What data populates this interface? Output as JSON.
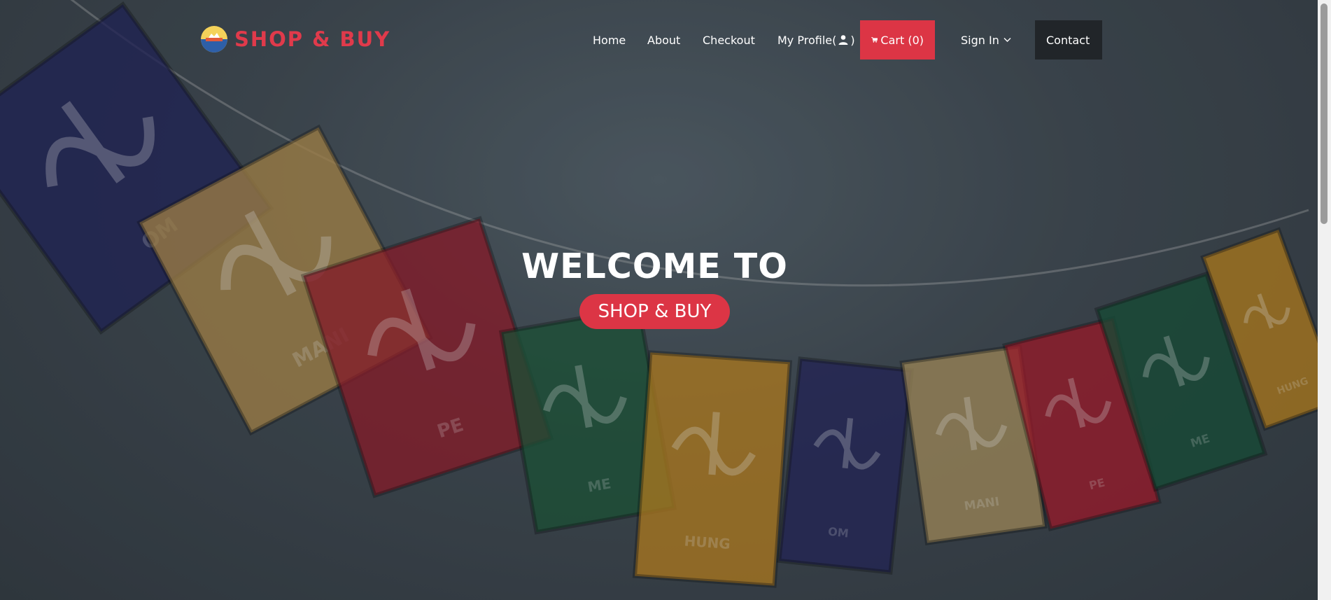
{
  "brand": {
    "name": "SHOP & BUY",
    "logo_icon": "sunrise-logo-icon"
  },
  "nav": {
    "home": "Home",
    "about": "About",
    "checkout": "Checkout",
    "profile": "My Profile(",
    "profile_close": ")",
    "cart": "Cart (0)",
    "signin": "Sign In",
    "contact": "Contact"
  },
  "hero": {
    "welcome": "WELCOME TO",
    "badge": "SHOP & BUY",
    "flag_labels": [
      "OM",
      "MANI",
      "PE",
      "ME",
      "HUNG",
      "OM",
      "MANI",
      "PE",
      "ME",
      "HUNG"
    ]
  },
  "colors": {
    "accent": "#dc3545",
    "brand": "#e03a4b",
    "dark": "#212529"
  }
}
